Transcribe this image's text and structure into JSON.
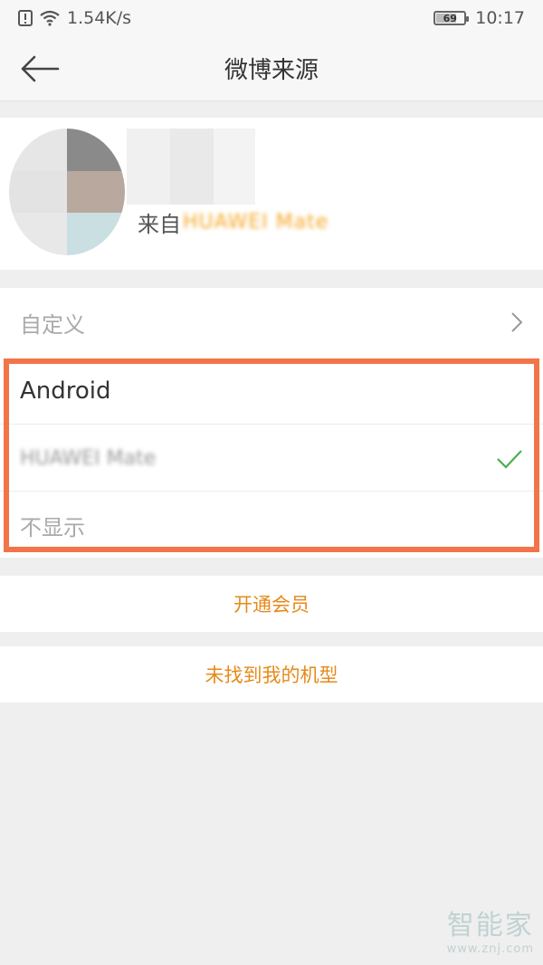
{
  "status_bar": {
    "net_speed": "1.54K/s",
    "battery_level": "69",
    "time": "10:17"
  },
  "header": {
    "title": "微博来源"
  },
  "profile": {
    "from_prefix": "来自",
    "from_device": "HUAWEI Mate"
  },
  "custom": {
    "label": "自定义"
  },
  "options": [
    {
      "label": "Android",
      "selected": false
    },
    {
      "label": "HUAWEI Mate",
      "selected": true
    },
    {
      "label": "不显示",
      "selected": false
    }
  ],
  "actions": {
    "open_vip": "开通会员",
    "not_found": "未找到我的机型"
  },
  "watermark": {
    "brand": "智能家",
    "url": "www.znj.com"
  },
  "colors": {
    "accent": "#e68a1a",
    "highlight": "#f2754a",
    "check": "#4caf50"
  }
}
